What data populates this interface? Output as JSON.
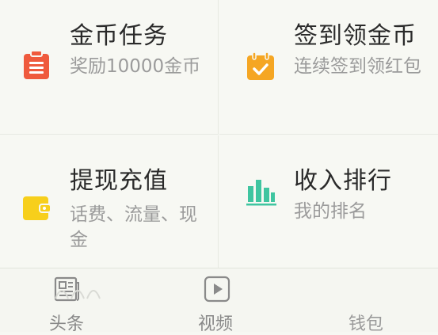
{
  "cards": [
    {
      "title": "金币任务",
      "desc": "奖励10000金币",
      "icon": "clipboard-icon",
      "color": "#ef5a3d"
    },
    {
      "title": "签到领金币",
      "desc": "连续签到领红包",
      "icon": "calendar-check-icon",
      "color": "#f5a623"
    },
    {
      "title": "提现充值",
      "desc": "话费、流量、现金",
      "icon": "wallet-icon",
      "color": "#f7cf1b"
    },
    {
      "title": "收入排行",
      "desc": "我的排名",
      "icon": "bar-chart-icon",
      "color": "#3fc5a0"
    }
  ],
  "tabbar": {
    "tabs": [
      {
        "label": "头条",
        "icon": "news-icon"
      },
      {
        "label": "视频",
        "icon": "play-icon"
      },
      {
        "label": "钱包",
        "icon": "wallet-tab-icon"
      }
    ]
  }
}
